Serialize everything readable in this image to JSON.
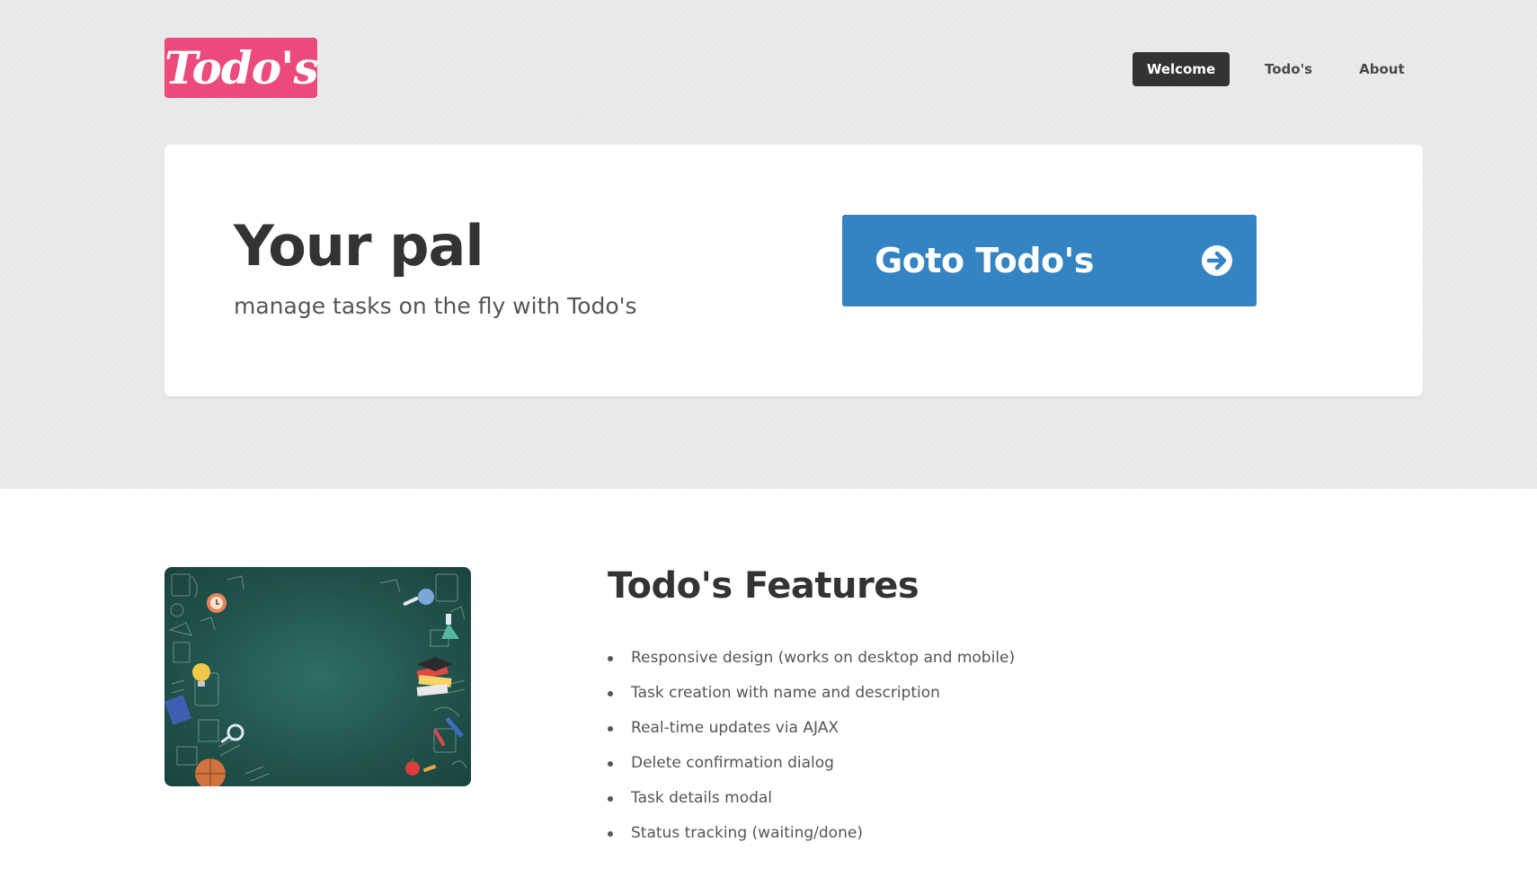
{
  "header": {
    "logo_text": "Todo's",
    "logo_color": "#ec4a7a",
    "nav": [
      {
        "label": "Welcome",
        "active": true
      },
      {
        "label": "Todo's",
        "active": false
      },
      {
        "label": "About",
        "active": false
      }
    ]
  },
  "hero": {
    "title": "Your pal",
    "subtitle": "manage tasks on the fly with Todo's",
    "cta_label": "Goto Todo's",
    "cta_icon": "arrow-right-circle-icon",
    "cta_color": "#3483c2"
  },
  "features": {
    "image_alt": "chalkboard-illustration",
    "title": "Todo's Features",
    "items": [
      "Responsive design (works on desktop and mobile)",
      "Task creation with name and description",
      "Real-time updates via AJAX",
      "Delete confirmation dialog",
      "Task details modal",
      "Status tracking (waiting/done)"
    ]
  }
}
